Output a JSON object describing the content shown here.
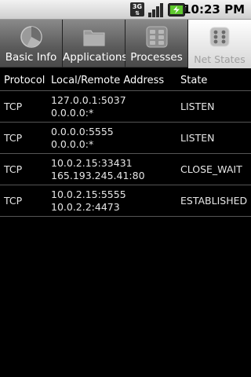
{
  "status_bar": {
    "network_type": "3G",
    "time": "10:23 PM"
  },
  "tabs": [
    {
      "label": "Basic Info",
      "icon": "pie-chart-icon",
      "selected": false
    },
    {
      "label": "Applications",
      "icon": "folder-icon",
      "selected": false
    },
    {
      "label": "Processes",
      "icon": "grid-icon",
      "selected": false
    },
    {
      "label": "Net States",
      "icon": "dice-icon",
      "selected": true
    }
  ],
  "table": {
    "headers": {
      "protocol": "Protocol",
      "address": "Local/Remote Address",
      "state": "State"
    },
    "rows": [
      {
        "protocol": "TCP",
        "local": "127.0.0.1:5037",
        "remote": "0.0.0.0:*",
        "state": "LISTEN"
      },
      {
        "protocol": "TCP",
        "local": "0.0.0.0:5555",
        "remote": "0.0.0.0:*",
        "state": "LISTEN"
      },
      {
        "protocol": "TCP",
        "local": "10.0.2.15:33431",
        "remote": "165.193.245.41:80",
        "state": "CLOSE_WAIT"
      },
      {
        "protocol": "TCP",
        "local": "10.0.2.15:5555",
        "remote": "10.0.2.2:4473",
        "state": "ESTABLISHED"
      }
    ]
  }
}
